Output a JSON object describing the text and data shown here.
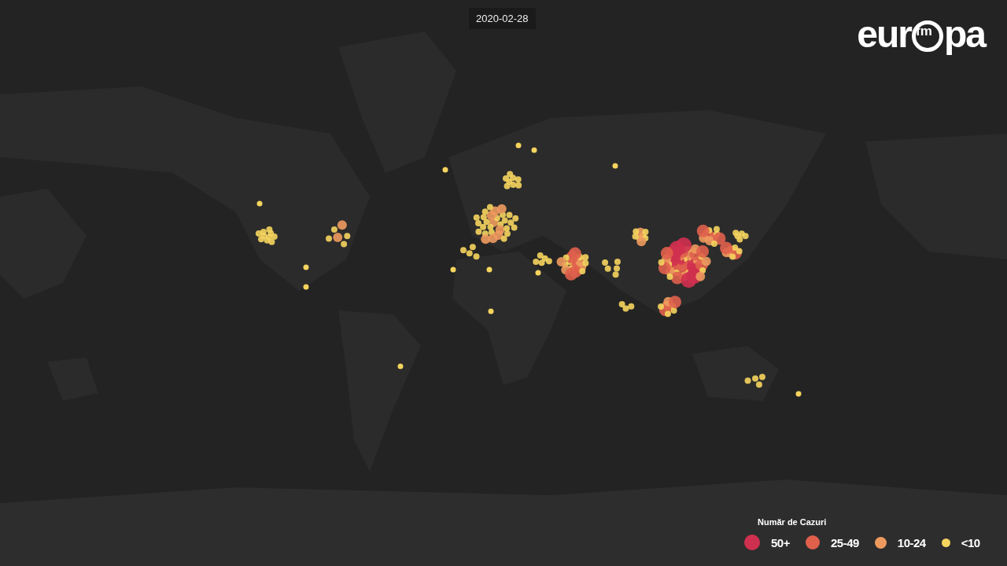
{
  "date_label": "2020-02-28",
  "logo": {
    "left": "eur",
    "badge": "fm",
    "right": "pa"
  },
  "legend": {
    "title": "Număr de Cazuri",
    "items": [
      {
        "label": "50+",
        "color": "#d0304f"
      },
      {
        "label": "25-49",
        "color": "#e0604c"
      },
      {
        "label": "10-24",
        "color": "#ee9a5e"
      },
      {
        "label": "<10",
        "color": "#f5d45e"
      }
    ]
  }
}
